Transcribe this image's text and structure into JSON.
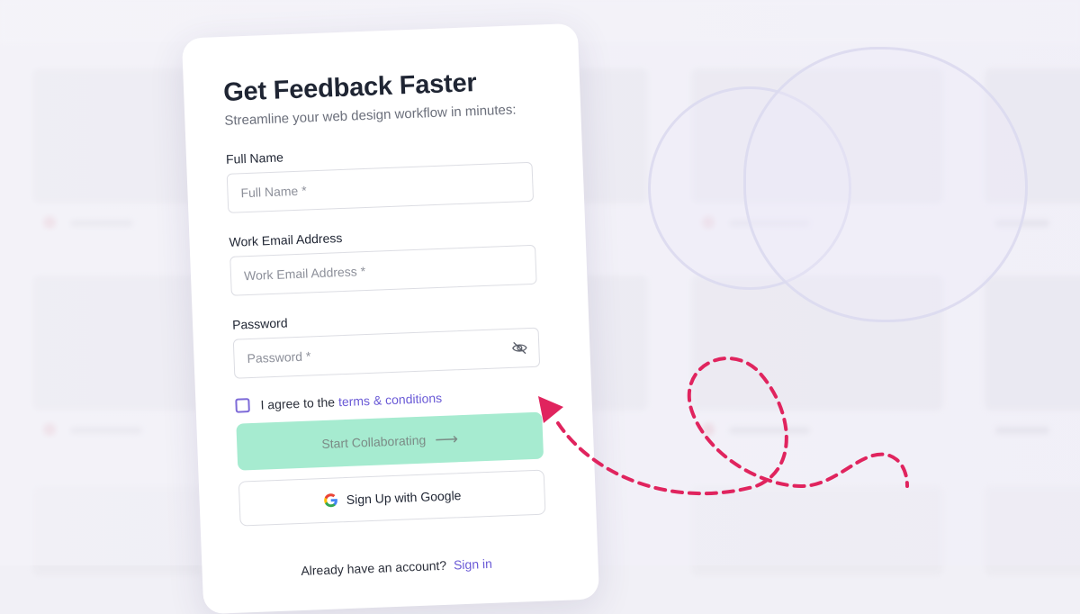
{
  "form": {
    "title": "Get Feedback Faster",
    "subtitle": "Streamline your web design workflow in minutes:",
    "full_name": {
      "label": "Full Name",
      "placeholder": "Full Name *"
    },
    "email": {
      "label": "Work Email Address",
      "placeholder": "Work Email Address *"
    },
    "password": {
      "label": "Password",
      "placeholder": "Password *",
      "toggle_icon": "eye-off-icon"
    },
    "terms": {
      "text": "I agree to the",
      "link": "terms & conditions",
      "checked": false
    },
    "primary_button": {
      "label": "Start Collaborating",
      "icon": "arrow-right-icon"
    },
    "google_button": {
      "label": "Sign Up with Google",
      "icon": "google-icon"
    },
    "signin": {
      "text": "Already have an account?",
      "link": "Sign in"
    }
  },
  "colors": {
    "accent": "#6a5ad6",
    "primary_button_bg": "#a6ebd0",
    "doodle": "#e0245e",
    "title": "#1f2533"
  }
}
